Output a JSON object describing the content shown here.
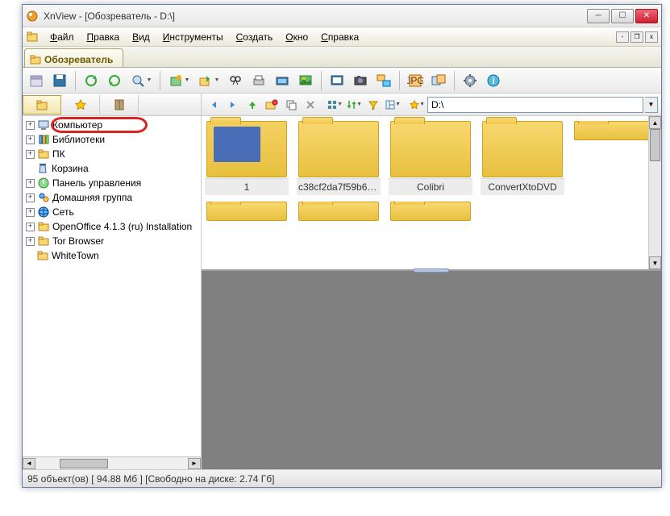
{
  "window": {
    "title": "XnView - [Обозреватель - D:\\]"
  },
  "menu": {
    "items": [
      "Файл",
      "Правка",
      "Вид",
      "Инструменты",
      "Создать",
      "Окно",
      "Справка"
    ]
  },
  "tab": {
    "label": "Обозреватель"
  },
  "nav": {
    "path": "D:\\"
  },
  "tree": {
    "items": [
      {
        "label": "Компьютер",
        "icon": "computer",
        "expandable": true,
        "highlighted": true
      },
      {
        "label": "Библиотеки",
        "icon": "libraries",
        "expandable": true
      },
      {
        "label": "ПК",
        "icon": "folder",
        "expandable": true
      },
      {
        "label": "Корзина",
        "icon": "recycle",
        "expandable": false
      },
      {
        "label": "Панель управления",
        "icon": "control",
        "expandable": true
      },
      {
        "label": "Домашняя группа",
        "icon": "homegroup",
        "expandable": true
      },
      {
        "label": "Сеть",
        "icon": "network",
        "expandable": true
      },
      {
        "label": "OpenOffice 4.1.3 (ru) Installation",
        "icon": "folder",
        "expandable": true
      },
      {
        "label": "Tor Browser",
        "icon": "folder",
        "expandable": true
      },
      {
        "label": "WhiteTown",
        "icon": "folder",
        "expandable": false
      }
    ]
  },
  "folders": {
    "row1": [
      {
        "name": "1",
        "special": true
      },
      {
        "name": "c38cf2da7f59b6c..."
      },
      {
        "name": "Colibri"
      },
      {
        "name": "ConvertXtoDVD"
      }
    ],
    "row2": [
      {
        "name": ""
      },
      {
        "name": ""
      },
      {
        "name": ""
      },
      {
        "name": ""
      }
    ]
  },
  "status": {
    "text": "95 объект(ов) [ 94.88 Мб ] [Свободно на диске: 2.74 Гб]"
  }
}
